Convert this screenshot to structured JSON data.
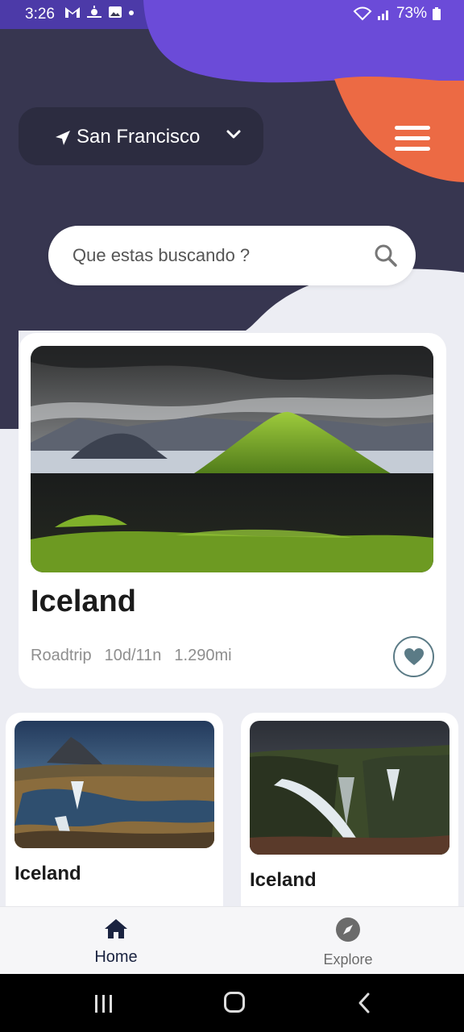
{
  "status_bar": {
    "time": "3:26",
    "battery": "73%",
    "icons": [
      "gmail-icon",
      "weather-icon",
      "gallery-icon",
      "dot-icon",
      "wifi-icon",
      "signal-icon",
      "battery-icon"
    ]
  },
  "colors": {
    "dark_bg": "#373650",
    "purple_blob": "#6b4bd8",
    "orange_blob": "#ec6a44",
    "light_bg": "#ecedf3",
    "pill_bg": "#2c2c40"
  },
  "location": {
    "city": "San Francisco",
    "icons": [
      "navigation-arrow-icon",
      "chevron-down-icon"
    ]
  },
  "search": {
    "placeholder": "Que estas buscando ?"
  },
  "featured": {
    "title": "Iceland",
    "meta": [
      "Roadtrip",
      "10d/11n",
      "1.290mi"
    ]
  },
  "cards": [
    {
      "title": "Iceland"
    },
    {
      "title": "Iceland"
    }
  ],
  "bottom_nav": {
    "home_label": "Home",
    "explore_label": "Explore"
  }
}
